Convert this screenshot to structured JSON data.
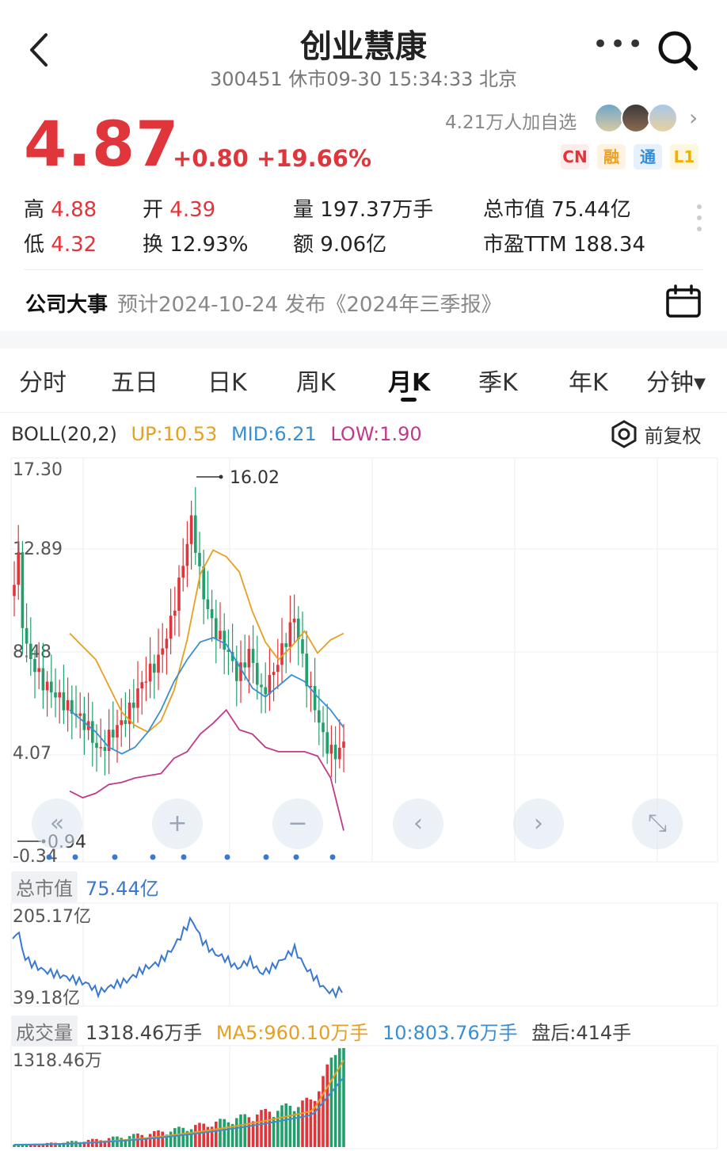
{
  "header": {
    "title": "创业慧康",
    "subtitle": "300451 休市09-30 15:34:33 北京"
  },
  "quote": {
    "price": "4.87",
    "change": "+0.80 +19.66%",
    "watchers": "4.21万人加自选",
    "badges": [
      "CN",
      "融",
      "通",
      "L1"
    ],
    "badge_colors": [
      "#e0353b",
      "#f0a020",
      "#2e8ee0",
      "#f0b000"
    ]
  },
  "stats": {
    "high_label": "高",
    "high_value": "4.88",
    "low_label": "低",
    "low_value": "4.32",
    "open_label": "开",
    "open_value": "4.39",
    "turnover_label": "换",
    "turnover_value": "12.93%",
    "volume_label": "量",
    "volume_value": "197.37万手",
    "amount_label": "额",
    "amount_value": "9.06亿",
    "mcap_label": "总市值",
    "mcap_value": "75.44亿",
    "pe_label": "市盈TTM",
    "pe_value": "188.34"
  },
  "event": {
    "label": "公司大事",
    "text": "预计2024-10-24 发布《2024年三季报》"
  },
  "tabs": [
    "分时",
    "五日",
    "日K",
    "周K",
    "月K",
    "季K",
    "年K",
    "分钟▾"
  ],
  "active_tab": "月K",
  "indicator": {
    "name": "BOLL(20,2)",
    "up": "UP:10.53",
    "mid": "MID:6.21",
    "low": "LOW:1.90",
    "fuquan": "前复权"
  },
  "kline_axis": {
    "labels": [
      "17.30",
      "12.89",
      "8.48",
      "4.07",
      "-0.34"
    ],
    "max_marker": "16.02",
    "min_marker": "0.94"
  },
  "market_cap": {
    "label": "总市值",
    "value": "75.44亿",
    "max": "205.17亿",
    "min": "39.18亿"
  },
  "volume": {
    "label": "成交量",
    "value": "1318.46万手",
    "ma5": "MA5:960.10万手",
    "ma10": "10:803.76万手",
    "after": "盘后:414手",
    "max": "1318.46万"
  },
  "colors": {
    "up": "#e0353b",
    "down": "#22a06b",
    "boll_up": "#e6a020",
    "boll_mid": "#3a8fd0",
    "boll_low": "#c03a8a"
  },
  "chart_data": {
    "type": "candlestick",
    "series": [
      {
        "name": "UP",
        "values": [
          9.8,
          9.2,
          8.6,
          7.4,
          6.2,
          5.6,
          5.3,
          5.8,
          7.2,
          9.5,
          12.5,
          13.6,
          13.3,
          12.6,
          10.8,
          9.4,
          8.6,
          9.2,
          9.9,
          8.9,
          9.5,
          9.8
        ]
      },
      {
        "name": "MID",
        "values": [
          6.3,
          5.8,
          5.3,
          4.6,
          4.3,
          4.6,
          5.3,
          6.3,
          7.6,
          8.6,
          9.4,
          9.6,
          9.3,
          8.3,
          7.3,
          6.9,
          7.4,
          7.9,
          7.6,
          6.9,
          6.3,
          5.5
        ]
      },
      {
        "name": "LOW",
        "values": [
          2.6,
          2.3,
          2.5,
          2.9,
          3.0,
          3.2,
          3.3,
          3.4,
          4.1,
          4.4,
          5.2,
          5.7,
          6.3,
          5.4,
          5.2,
          4.6,
          4.4,
          4.4,
          4.4,
          4.2,
          3.2,
          0.8
        ]
      }
    ]
  }
}
